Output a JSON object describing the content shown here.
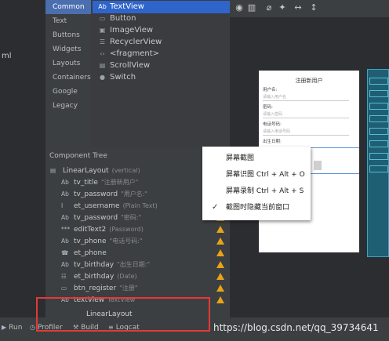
{
  "left_strip": {
    "fragment_text": "ml"
  },
  "palette": {
    "categories": [
      "Common",
      "Text",
      "Buttons",
      "Widgets",
      "Layouts",
      "Containers",
      "Google",
      "Legacy"
    ],
    "active_category": "Common",
    "items": [
      {
        "icon": "Ab",
        "label": "TextView"
      },
      {
        "icon": "▭",
        "label": "Button"
      },
      {
        "icon": "▣",
        "label": "ImageView"
      },
      {
        "icon": "☰",
        "label": "RecyclerView"
      },
      {
        "icon": "‹›",
        "label": "<fragment>"
      },
      {
        "icon": "▤",
        "label": "ScrollView"
      },
      {
        "icon": "●",
        "label": "Switch"
      }
    ]
  },
  "component_tree": {
    "header": "Component Tree",
    "rows": [
      {
        "icon": "▤",
        "name": "LinearLayout",
        "meta": "(vertical)",
        "warning": false
      },
      {
        "icon": "Ab",
        "name": "tv_title",
        "meta": "\"注册新用户\"",
        "warning": false
      },
      {
        "icon": "Ab",
        "name": "tv_password",
        "meta": "\"用户名:\"",
        "warning": true
      },
      {
        "icon": "I",
        "name": "et_username",
        "meta": "(Plain Text)",
        "warning": true
      },
      {
        "icon": "Ab",
        "name": "tv_password",
        "meta": "\"密码:\"",
        "warning": true
      },
      {
        "icon": "***",
        "name": "editText2",
        "meta": "(Password)",
        "warning": true
      },
      {
        "icon": "Ab",
        "name": "tv_phone",
        "meta": "\"电话号码:\"",
        "warning": true
      },
      {
        "icon": "☎",
        "name": "et_phone",
        "meta": "",
        "warning": true
      },
      {
        "icon": "Ab",
        "name": "tv_birthday",
        "meta": "\"出生日期:\"",
        "warning": true
      },
      {
        "icon": "☷",
        "name": "et_birthday",
        "meta": "(Date)",
        "warning": true
      },
      {
        "icon": "▭",
        "name": "btn_register",
        "meta": "\"注册\"",
        "warning": true
      },
      {
        "icon": "Ab",
        "name": "textView",
        "meta": "TextView",
        "warning": true
      }
    ]
  },
  "canvas": {
    "toolbar_icons": [
      "eye-icon",
      "blueprint-icon",
      "magnet-off-icon",
      "magic-wand-icon",
      "horizontal-arrows-icon",
      "vertical-arrows-icon"
    ],
    "phone": {
      "title": "注册新用户",
      "fields": [
        {
          "label": "用户名:",
          "hint": "请输入用户名"
        },
        {
          "label": "密码:",
          "hint": "请输入密码"
        },
        {
          "label": "电话号码:",
          "hint": "请输入电话号码"
        },
        {
          "label": "出生日期:",
          "hint": ""
        }
      ]
    }
  },
  "context_menu": {
    "items": [
      {
        "label": "屏幕截图",
        "checked": false
      },
      {
        "label": "屏幕识图 Ctrl + Alt + O",
        "checked": false
      },
      {
        "label": "屏幕录制 Ctrl + Alt + S",
        "checked": false
      },
      {
        "label": "截图时隐藏当前窗口",
        "checked": true
      }
    ]
  },
  "breadcrumb": "LinearLayout",
  "bottom_bar": {
    "tabs": [
      {
        "icon": "▶",
        "label": "Run"
      },
      {
        "icon": "◷",
        "label": "Profiler"
      },
      {
        "icon": "⚒",
        "label": "Build"
      },
      {
        "icon": "≡",
        "label": "Logcat"
      }
    ]
  },
  "watermark": "https://blog.csdn.net/qq_39734641",
  "colors": {
    "accent": "#2f65ca",
    "warning": "#e8a317",
    "highlight_box": "#e53935"
  }
}
